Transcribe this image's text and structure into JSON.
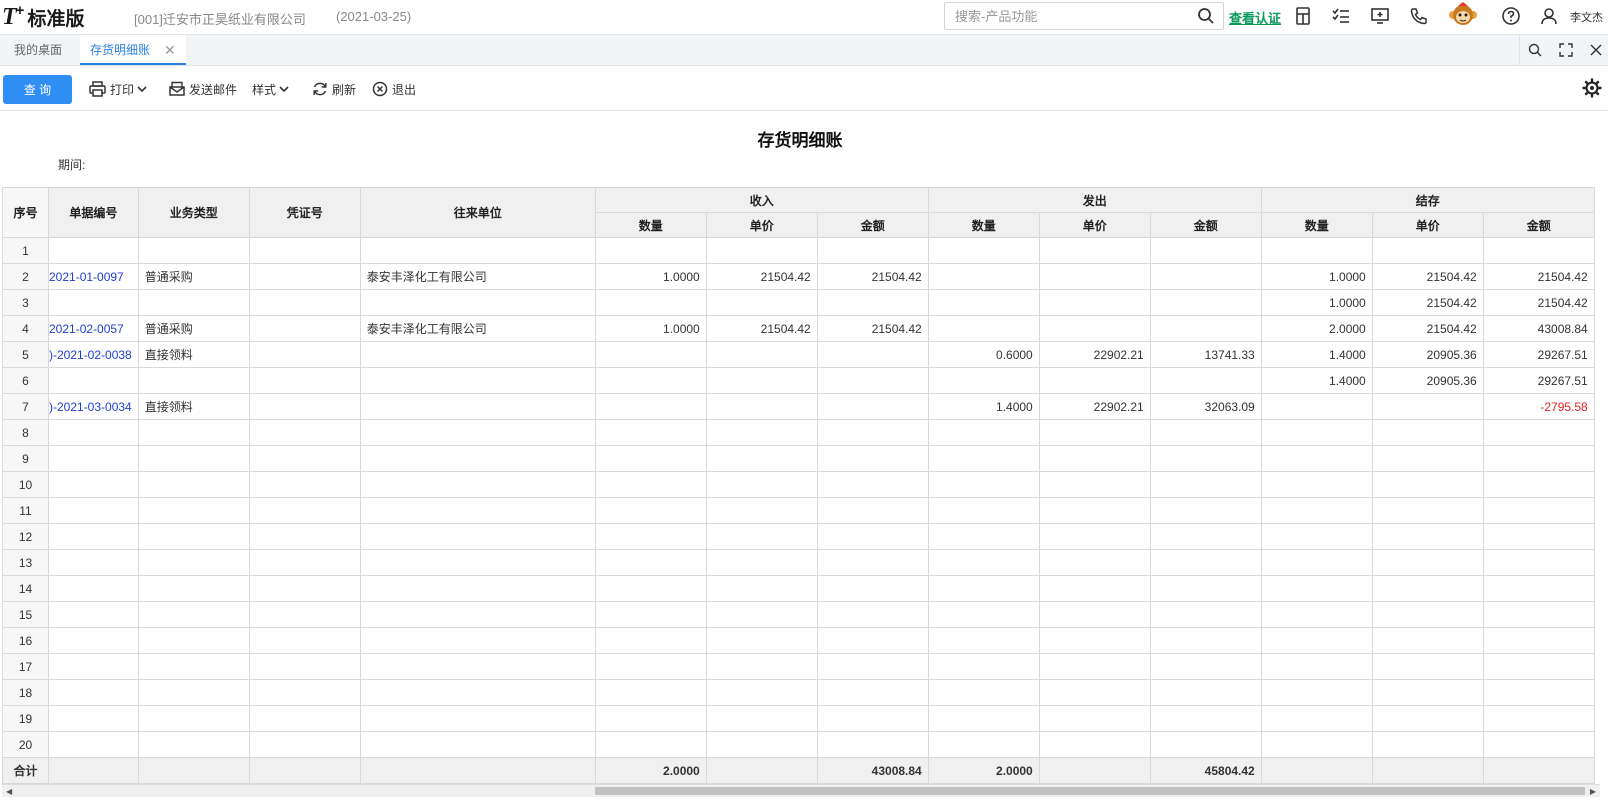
{
  "header": {
    "logo_text": "T",
    "logo_plus": "+",
    "edition": "标准版",
    "company": "[001]迁安市正昊纸业有限公司",
    "date": "(2021-03-25)",
    "search_placeholder": "搜索-产品功能",
    "verify_link": "查看认证",
    "username": "李文杰"
  },
  "tabs": {
    "home": "我的桌面",
    "current": "存货明细账",
    "close": "✕"
  },
  "toolbar": {
    "query": "查 询",
    "print": "打印",
    "send_mail": "发送邮件",
    "style": "样式",
    "refresh": "刷新",
    "exit": "退出"
  },
  "report": {
    "title": "存货明细账",
    "period_label": "期间:",
    "headers": {
      "seq": "序号",
      "doc_no": "单据编号",
      "biz_type": "业务类型",
      "voucher": "凭证号",
      "partner": "往来单位",
      "income": "收入",
      "issue": "发出",
      "balance": "结存",
      "qty": "数量",
      "price": "单价",
      "amount": "金额"
    },
    "rows": [
      {
        "seq": "1",
        "doc": "",
        "type": "",
        "voucher": "",
        "partner": "",
        "in_qty": "",
        "in_price": "",
        "in_amt": "",
        "out_qty": "",
        "out_price": "",
        "out_amt": "",
        "bal_qty": "",
        "bal_price": "",
        "bal_amt": ""
      },
      {
        "seq": "2",
        "doc": "2021-01-0097",
        "type": "普通采购",
        "voucher": "",
        "partner": "泰安丰泽化工有限公司",
        "in_qty": "1.0000",
        "in_price": "21504.42",
        "in_amt": "21504.42",
        "out_qty": "",
        "out_price": "",
        "out_amt": "",
        "bal_qty": "1.0000",
        "bal_price": "21504.42",
        "bal_amt": "21504.42"
      },
      {
        "seq": "3",
        "doc": "",
        "type": "",
        "voucher": "",
        "partner": "",
        "in_qty": "",
        "in_price": "",
        "in_amt": "",
        "out_qty": "",
        "out_price": "",
        "out_amt": "",
        "bal_qty": "1.0000",
        "bal_price": "21504.42",
        "bal_amt": "21504.42"
      },
      {
        "seq": "4",
        "doc": "2021-02-0057",
        "type": "普通采购",
        "voucher": "",
        "partner": "泰安丰泽化工有限公司",
        "in_qty": "1.0000",
        "in_price": "21504.42",
        "in_amt": "21504.42",
        "out_qty": "",
        "out_price": "",
        "out_amt": "",
        "bal_qty": "2.0000",
        "bal_price": "21504.42",
        "bal_amt": "43008.84"
      },
      {
        "seq": "5",
        "doc": ")-2021-02-0038",
        "type": "直接领料",
        "voucher": "",
        "partner": "",
        "in_qty": "",
        "in_price": "",
        "in_amt": "",
        "out_qty": "0.6000",
        "out_price": "22902.21",
        "out_amt": "13741.33",
        "bal_qty": "1.4000",
        "bal_price": "20905.36",
        "bal_amt": "29267.51"
      },
      {
        "seq": "6",
        "doc": "",
        "type": "",
        "voucher": "",
        "partner": "",
        "in_qty": "",
        "in_price": "",
        "in_amt": "",
        "out_qty": "",
        "out_price": "",
        "out_amt": "",
        "bal_qty": "1.4000",
        "bal_price": "20905.36",
        "bal_amt": "29267.51"
      },
      {
        "seq": "7",
        "doc": ")-2021-03-0034",
        "type": "直接领料",
        "voucher": "",
        "partner": "",
        "in_qty": "",
        "in_price": "",
        "in_amt": "",
        "out_qty": "1.4000",
        "out_price": "22902.21",
        "out_amt": "32063.09",
        "bal_qty": "",
        "bal_price": "",
        "bal_amt": "-2795.58"
      },
      {
        "seq": "8",
        "doc": "",
        "type": "",
        "voucher": "",
        "partner": "",
        "in_qty": "",
        "in_price": "",
        "in_amt": "",
        "out_qty": "",
        "out_price": "",
        "out_amt": "",
        "bal_qty": "",
        "bal_price": "",
        "bal_amt": ""
      },
      {
        "seq": "9",
        "doc": "",
        "type": "",
        "voucher": "",
        "partner": "",
        "in_qty": "",
        "in_price": "",
        "in_amt": "",
        "out_qty": "",
        "out_price": "",
        "out_amt": "",
        "bal_qty": "",
        "bal_price": "",
        "bal_amt": ""
      },
      {
        "seq": "10",
        "doc": "",
        "type": "",
        "voucher": "",
        "partner": "",
        "in_qty": "",
        "in_price": "",
        "in_amt": "",
        "out_qty": "",
        "out_price": "",
        "out_amt": "",
        "bal_qty": "",
        "bal_price": "",
        "bal_amt": ""
      },
      {
        "seq": "11",
        "doc": "",
        "type": "",
        "voucher": "",
        "partner": "",
        "in_qty": "",
        "in_price": "",
        "in_amt": "",
        "out_qty": "",
        "out_price": "",
        "out_amt": "",
        "bal_qty": "",
        "bal_price": "",
        "bal_amt": ""
      },
      {
        "seq": "12",
        "doc": "",
        "type": "",
        "voucher": "",
        "partner": "",
        "in_qty": "",
        "in_price": "",
        "in_amt": "",
        "out_qty": "",
        "out_price": "",
        "out_amt": "",
        "bal_qty": "",
        "bal_price": "",
        "bal_amt": ""
      },
      {
        "seq": "13",
        "doc": "",
        "type": "",
        "voucher": "",
        "partner": "",
        "in_qty": "",
        "in_price": "",
        "in_amt": "",
        "out_qty": "",
        "out_price": "",
        "out_amt": "",
        "bal_qty": "",
        "bal_price": "",
        "bal_amt": ""
      },
      {
        "seq": "14",
        "doc": "",
        "type": "",
        "voucher": "",
        "partner": "",
        "in_qty": "",
        "in_price": "",
        "in_amt": "",
        "out_qty": "",
        "out_price": "",
        "out_amt": "",
        "bal_qty": "",
        "bal_price": "",
        "bal_amt": ""
      },
      {
        "seq": "15",
        "doc": "",
        "type": "",
        "voucher": "",
        "partner": "",
        "in_qty": "",
        "in_price": "",
        "in_amt": "",
        "out_qty": "",
        "out_price": "",
        "out_amt": "",
        "bal_qty": "",
        "bal_price": "",
        "bal_amt": ""
      },
      {
        "seq": "16",
        "doc": "",
        "type": "",
        "voucher": "",
        "partner": "",
        "in_qty": "",
        "in_price": "",
        "in_amt": "",
        "out_qty": "",
        "out_price": "",
        "out_amt": "",
        "bal_qty": "",
        "bal_price": "",
        "bal_amt": ""
      },
      {
        "seq": "17",
        "doc": "",
        "type": "",
        "voucher": "",
        "partner": "",
        "in_qty": "",
        "in_price": "",
        "in_amt": "",
        "out_qty": "",
        "out_price": "",
        "out_amt": "",
        "bal_qty": "",
        "bal_price": "",
        "bal_amt": ""
      },
      {
        "seq": "18",
        "doc": "",
        "type": "",
        "voucher": "",
        "partner": "",
        "in_qty": "",
        "in_price": "",
        "in_amt": "",
        "out_qty": "",
        "out_price": "",
        "out_amt": "",
        "bal_qty": "",
        "bal_price": "",
        "bal_amt": ""
      },
      {
        "seq": "19",
        "doc": "",
        "type": "",
        "voucher": "",
        "partner": "",
        "in_qty": "",
        "in_price": "",
        "in_amt": "",
        "out_qty": "",
        "out_price": "",
        "out_amt": "",
        "bal_qty": "",
        "bal_price": "",
        "bal_amt": ""
      },
      {
        "seq": "20",
        "doc": "",
        "type": "",
        "voucher": "",
        "partner": "",
        "in_qty": "",
        "in_price": "",
        "in_amt": "",
        "out_qty": "",
        "out_price": "",
        "out_amt": "",
        "bal_qty": "",
        "bal_price": "",
        "bal_amt": ""
      }
    ],
    "total": {
      "label": "合计",
      "in_qty": "2.0000",
      "in_amt": "43008.84",
      "out_qty": "2.0000",
      "out_amt": "45804.42"
    }
  },
  "colors": {
    "accent": "#2f8ef4",
    "link": "#1f3fd0",
    "negative": "#e02020",
    "verify": "#0a9a5a"
  },
  "icons": [
    "search-icon",
    "calculator-icon",
    "checklist-icon",
    "message-icon",
    "phone-icon",
    "mascot-icon",
    "help-icon",
    "user-icon",
    "print-icon",
    "mail-icon",
    "refresh-icon",
    "exit-icon",
    "gear-icon"
  ]
}
